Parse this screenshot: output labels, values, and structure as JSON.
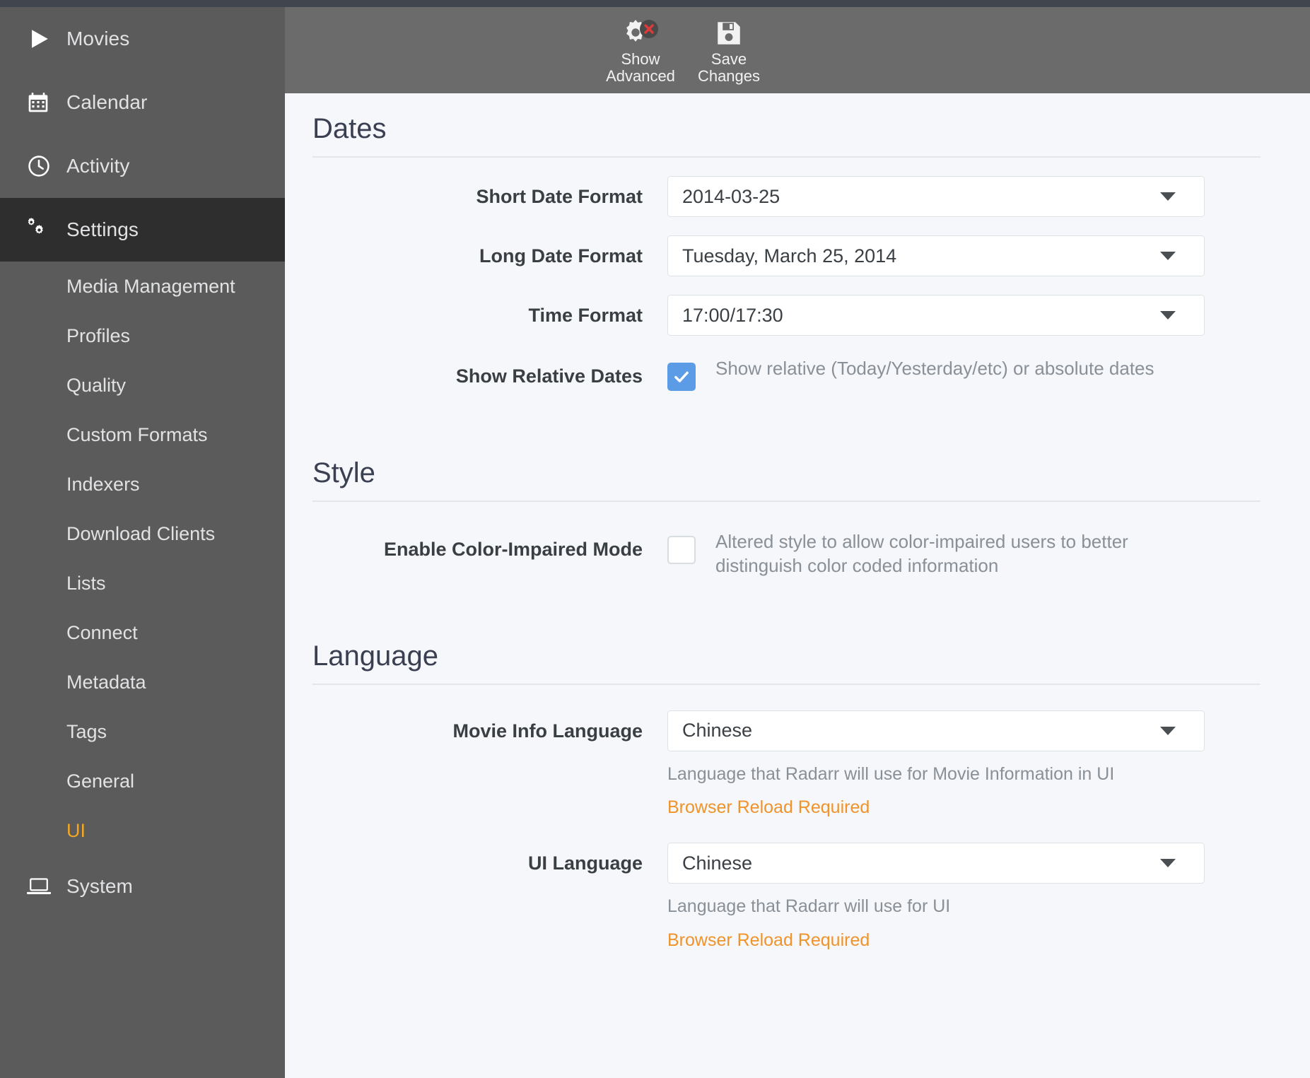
{
  "app": {
    "name": "Radarr"
  },
  "sidebar": {
    "items": [
      {
        "label": "Movies",
        "icon": "play-icon",
        "active": false
      },
      {
        "label": "Calendar",
        "icon": "calendar-icon",
        "active": false
      },
      {
        "label": "Activity",
        "icon": "clock-icon",
        "active": false
      },
      {
        "label": "Settings",
        "icon": "gears-icon",
        "active": true
      }
    ],
    "sub_items": [
      {
        "label": "Media Management",
        "selected": false
      },
      {
        "label": "Profiles",
        "selected": false
      },
      {
        "label": "Quality",
        "selected": false
      },
      {
        "label": "Custom Formats",
        "selected": false
      },
      {
        "label": "Indexers",
        "selected": false
      },
      {
        "label": "Download Clients",
        "selected": false
      },
      {
        "label": "Lists",
        "selected": false
      },
      {
        "label": "Connect",
        "selected": false
      },
      {
        "label": "Metadata",
        "selected": false
      },
      {
        "label": "Tags",
        "selected": false
      },
      {
        "label": "General",
        "selected": false
      },
      {
        "label": "UI",
        "selected": true
      }
    ],
    "footer_item": {
      "label": "System",
      "icon": "laptop-icon"
    },
    "selected_color": "#f5a623",
    "active_bg": "#2e2e2e",
    "bg": "#5b5b5b"
  },
  "toolbar": {
    "show_advanced": {
      "label": "Show\nAdvanced",
      "icon": "gear-with-x-icon"
    },
    "save_changes": {
      "label": "Save\nChanges",
      "icon": "floppy-disk-icon"
    },
    "bg": "#6b6b6b"
  },
  "sections": {
    "dates": {
      "title": "Dates",
      "short_date": {
        "label": "Short Date Format",
        "value": "2014-03-25"
      },
      "long_date": {
        "label": "Long Date Format",
        "value": "Tuesday, March 25, 2014"
      },
      "time_format": {
        "label": "Time Format",
        "value": "17:00/17:30"
      },
      "relative_dates": {
        "label": "Show Relative Dates",
        "checked": true,
        "description": "Show relative (Today/Yesterday/etc) or absolute dates"
      }
    },
    "style": {
      "title": "Style",
      "color_impaired": {
        "label": "Enable Color-Impaired Mode",
        "checked": false,
        "description": "Altered style to allow color-impaired users to better distinguish color coded information"
      }
    },
    "language": {
      "title": "Language",
      "movie_info_language": {
        "label": "Movie Info Language",
        "value": "Chinese",
        "help": "Language that Radarr will use for Movie Information in UI",
        "warning": "Browser Reload Required"
      },
      "ui_language": {
        "label": "UI Language",
        "value": "Chinese",
        "help": "Language that Radarr will use for UI",
        "warning": "Browser Reload Required"
      }
    }
  },
  "colors": {
    "accent": "#f5a623",
    "checkbox_checked": "#5c9ce6",
    "content_bg": "#f5f7fa",
    "top_strip": "#41454e",
    "warning": "#f0932b"
  }
}
